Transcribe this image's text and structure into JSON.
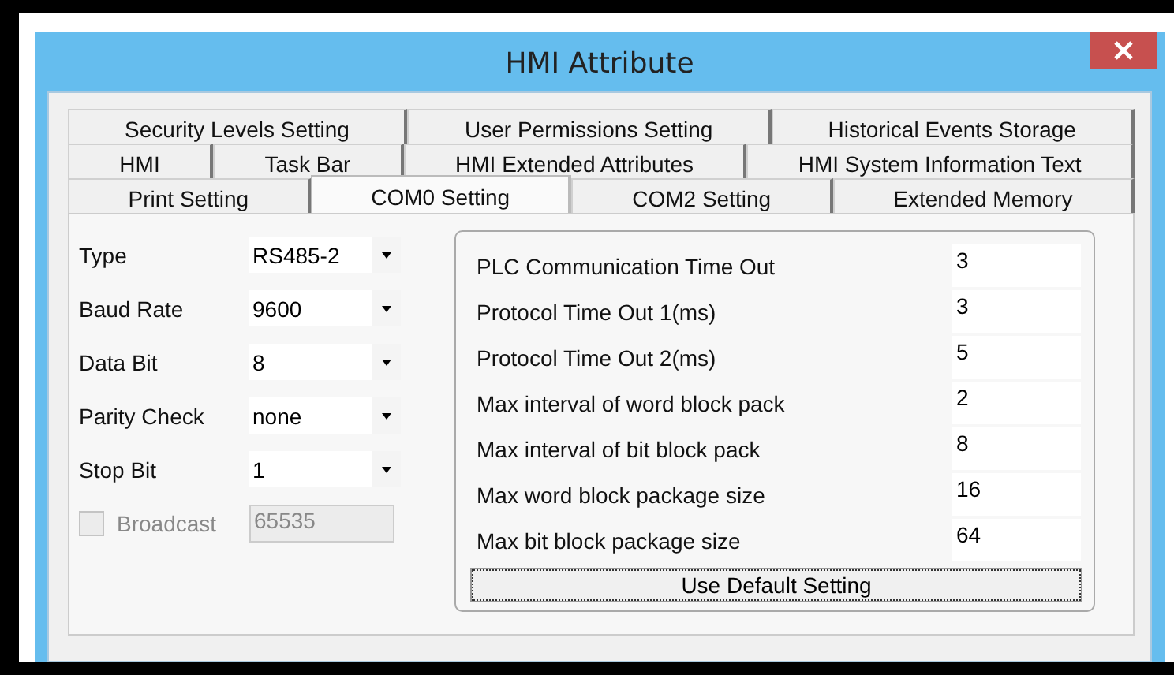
{
  "window": {
    "title": "HMI Attribute"
  },
  "tab_rows": [
    [
      {
        "label": "Security Levels Setting",
        "selected": false
      },
      {
        "label": "User Permissions Setting",
        "selected": false
      },
      {
        "label": "Historical Events Storage",
        "selected": false
      }
    ],
    [
      {
        "label": "HMI",
        "selected": false
      },
      {
        "label": "Task Bar",
        "selected": false
      },
      {
        "label": "HMI Extended Attributes",
        "selected": false
      },
      {
        "label": "HMI System Information Text",
        "selected": false
      }
    ],
    [
      {
        "label": "Print Setting",
        "selected": false
      },
      {
        "label": "COM0 Setting",
        "selected": true
      },
      {
        "label": "COM2 Setting",
        "selected": false
      },
      {
        "label": "Extended Memory",
        "selected": false
      }
    ]
  ],
  "port_settings": [
    {
      "label": "Type",
      "value": "RS485-2"
    },
    {
      "label": "Baud Rate",
      "value": "9600"
    },
    {
      "label": "Data Bit",
      "value": "8"
    },
    {
      "label": "Parity Check",
      "value": "none"
    },
    {
      "label": "Stop Bit",
      "value": "1"
    }
  ],
  "broadcast": {
    "label": "Broadcast",
    "checked": false,
    "disabled": true,
    "value": "65535"
  },
  "timing": [
    {
      "label": "PLC Communication Time Out",
      "value": "3"
    },
    {
      "label": "Protocol Time Out 1(ms)",
      "value": "3"
    },
    {
      "label": "Protocol Time Out 2(ms)",
      "value": "5"
    },
    {
      "label": "Max interval of word block pack",
      "value": "2"
    },
    {
      "label": "Max interval of bit block pack",
      "value": "8"
    },
    {
      "label": "Max word block package size",
      "value": "16"
    },
    {
      "label": "Max bit block package size",
      "value": "64"
    }
  ],
  "default_button": "Use Default Setting"
}
